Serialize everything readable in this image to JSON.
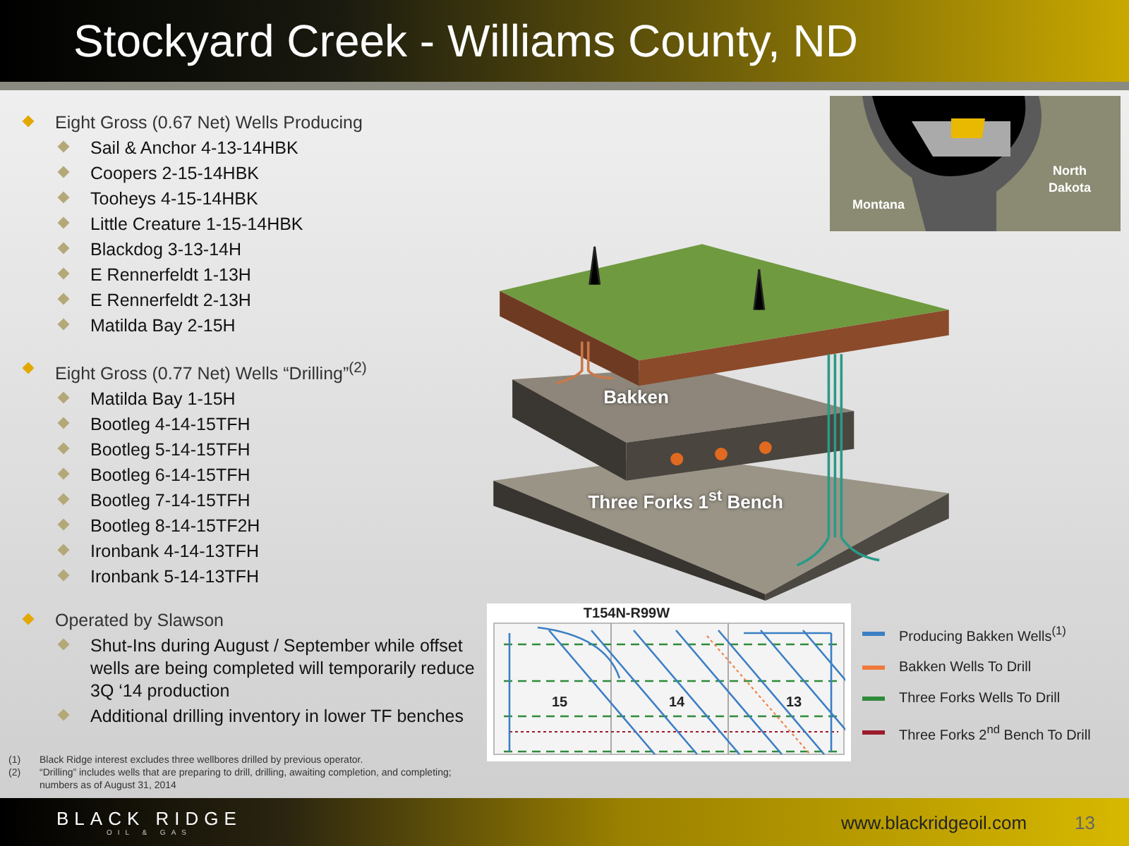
{
  "title": "Stockyard Creek - Williams County, ND",
  "bullets": [
    {
      "text": "Eight Gross (0.67 Net) Wells Producing",
      "children": [
        "Sail & Anchor 4-13-14HBK",
        "Coopers 2-15-14HBK",
        "Tooheys 4-15-14HBK",
        "Little Creature 1-15-14HBK",
        "Blackdog 3-13-14H",
        "E Rennerfeldt 1-13H",
        "E Rennerfeldt 2-13H",
        "Matilda Bay 2-15H"
      ]
    },
    {
      "text": "Eight Gross (0.77 Net) Wells “Drilling”$^{(2)}$",
      "children": [
        "Matilda Bay 1-15H",
        "Bootleg 4-14-15TFH",
        "Bootleg 5-14-15TFH",
        "Bootleg 6-14-15TFH",
        "Bootleg 7-14-15TFH",
        "Bootleg 8-14-15TF2H",
        "Ironbank 4-14-13TFH",
        "Ironbank 5-14-13TFH"
      ]
    },
    {
      "text": "Operated by Slawson",
      "children": [
        "Shut-Ins during August / September while offset wells are being completed will temporarily reduce 3Q ‘14 production",
        "Additional drilling inventory in lower TF benches"
      ]
    }
  ],
  "footnotes": [
    {
      "mark": "(1)",
      "text": "Black Ridge interest excludes three wellbores drilled by previous operator."
    },
    {
      "mark": "(2)",
      "text": "“Drilling” includes wells that are preparing to drill, drilling, awaiting completion, and completing; numbers as of August 31, 2014"
    }
  ],
  "map": {
    "labels": [
      "Montana",
      "North Dakota"
    ]
  },
  "block_diagram": {
    "layers": [
      "Bakken",
      "Three Forks 1$^{st}$ Bench"
    ]
  },
  "well_map": {
    "township": "T154N-R99W",
    "sections": [
      "15",
      "14",
      "13"
    ]
  },
  "legend": [
    {
      "label": "Producing Bakken Wells$^{(1)}$",
      "color": "#3b7fc4"
    },
    {
      "label": "Bakken Wells To Drill",
      "color": "#f07a3a"
    },
    {
      "label": "Three Forks Wells To Drill",
      "color": "#2e8b3a"
    },
    {
      "label": "Three Forks 2$^{nd}$ Bench To Drill",
      "color": "#9b1c2c"
    }
  ],
  "footer": {
    "logo": "BLACK RIDGE",
    "logo_sub": "OIL & GAS",
    "url": "www.blackridgeoil.com",
    "page": "13"
  }
}
